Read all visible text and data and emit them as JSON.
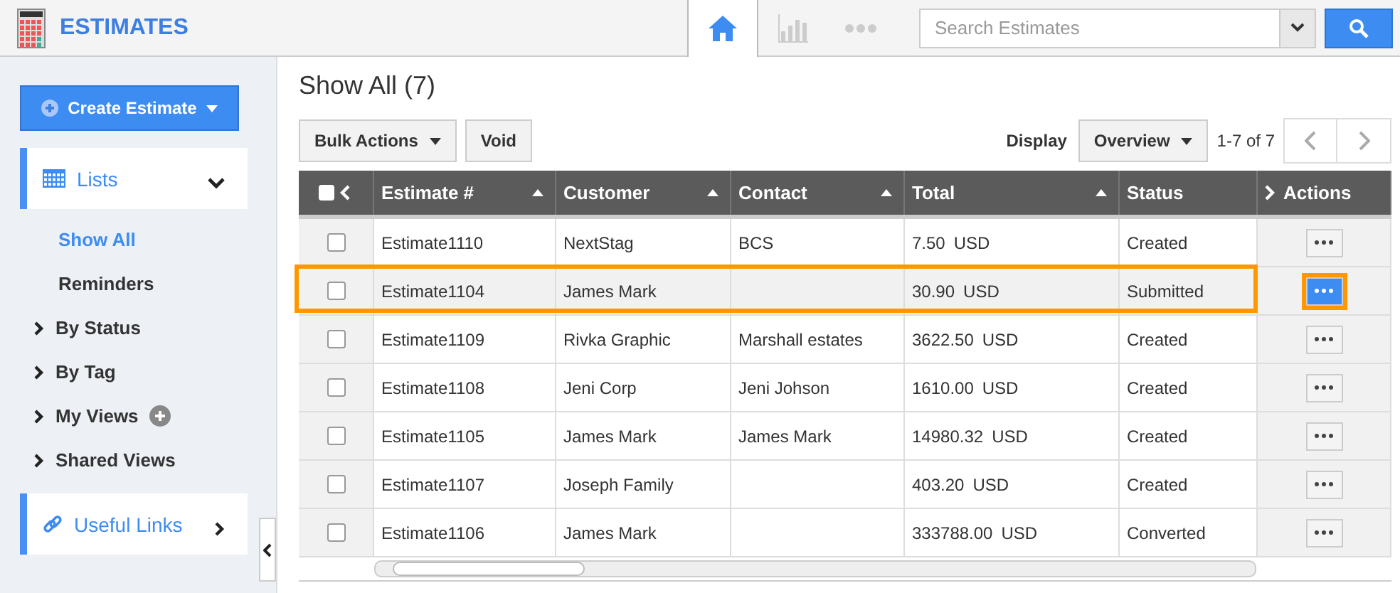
{
  "app": {
    "title": "ESTIMATES"
  },
  "nav_tabs": [
    {
      "kind": "home",
      "selected": true
    },
    {
      "kind": "chart",
      "selected": false
    },
    {
      "kind": "more",
      "selected": false
    }
  ],
  "search": {
    "placeholder": "Search Estimates"
  },
  "sidebar": {
    "create_button": "Create Estimate",
    "lists": {
      "label": "Lists",
      "expanded": true
    },
    "items": [
      {
        "label": "Show All",
        "kind": "link",
        "selected": true
      },
      {
        "label": "Reminders",
        "kind": "link",
        "selected": false
      },
      {
        "label": "By Status",
        "kind": "group",
        "selected": false
      },
      {
        "label": "By Tag",
        "kind": "group",
        "selected": false
      },
      {
        "label": "My Views",
        "kind": "group",
        "selected": false,
        "addable": true
      },
      {
        "label": "Shared Views",
        "kind": "group",
        "selected": false
      }
    ],
    "useful_links": "Useful Links"
  },
  "page_title": "Show All (7)",
  "toolbar": {
    "bulk_actions": "Bulk Actions",
    "void": "Void",
    "display_label": "Display",
    "display_value": "Overview",
    "range": "1-7 of 7"
  },
  "table": {
    "select_all_checked": false,
    "columns": [
      "Estimate #",
      "Customer",
      "Contact",
      "Total",
      "Status",
      "Actions"
    ],
    "rows": [
      {
        "estimate": "Estimate1110",
        "customer": "NextStag",
        "contact": "BCS",
        "amount": "7.50",
        "currency": "USD",
        "status": "Created",
        "checked": false,
        "selected": false
      },
      {
        "estimate": "Estimate1104",
        "customer": "James Mark",
        "amount": "30.90",
        "currency": "USD",
        "status": "Submitted",
        "checked": false,
        "selected": true
      },
      {
        "estimate": "Estimate1109",
        "customer": "Rivka Graphic",
        "contact": "Marshall estates",
        "amount": "3622.50",
        "currency": "USD",
        "status": "Created",
        "checked": false,
        "selected": false
      },
      {
        "estimate": "Estimate1108",
        "customer": "Jeni Corp",
        "contact": "Jeni Johson",
        "amount": "1610.00",
        "currency": "USD",
        "status": "Created",
        "checked": false,
        "selected": false
      },
      {
        "estimate": "Estimate1105",
        "customer": "James Mark",
        "contact": "James Mark",
        "amount": "14980.32",
        "currency": "USD",
        "status": "Created",
        "checked": false,
        "selected": false
      },
      {
        "estimate": "Estimate1107",
        "customer": "Joseph Family",
        "amount": "403.20",
        "currency": "USD",
        "status": "Created",
        "checked": false,
        "selected": false
      },
      {
        "estimate": "Estimate1106",
        "customer": "James Mark",
        "amount": "333788.00",
        "currency": "USD",
        "status": "Converted",
        "checked": false,
        "selected": false
      }
    ]
  }
}
